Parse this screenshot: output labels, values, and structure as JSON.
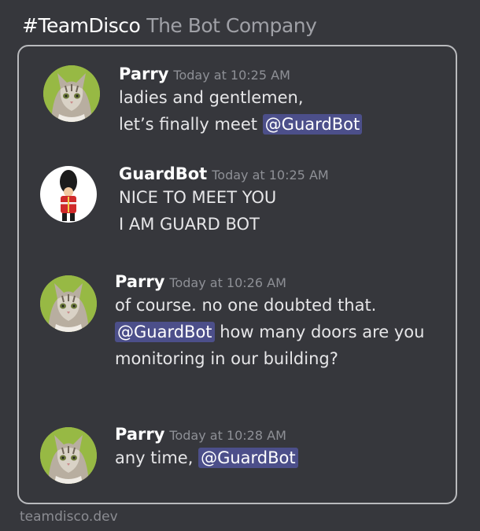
{
  "header": {
    "channel": "#TeamDisco",
    "company": "The Bot Company"
  },
  "messages": [
    {
      "author": "Parry",
      "time": "Today at 10:25 AM",
      "avatar": "cat-avatar",
      "line1": "ladies and gentlemen,",
      "line2_text": "let’s finally meet ",
      "line2_mention": "@GuardBot"
    },
    {
      "author": "GuardBot",
      "time": "Today at 10:25 AM",
      "avatar": "royal-guard-avatar",
      "line1": "NICE TO MEET YOU",
      "line2": "I AM GUARD BOT"
    },
    {
      "author": "Parry",
      "time": "Today at 10:26 AM",
      "avatar": "cat-avatar",
      "line1": "of course.  no one doubted that.",
      "line2_mention": "@GuardBot",
      "line2_text": " how many doors are you",
      "line3": "monitoring in our building?"
    },
    {
      "author": "Parry",
      "time": "Today at 10:28 AM",
      "avatar": "cat-avatar",
      "line1_text": "any time, ",
      "line1_mention": "@GuardBot"
    }
  ],
  "footer": {
    "site": "teamdisco.dev"
  },
  "colors": {
    "background": "#36373c",
    "mention_bg": "#4c4f8a",
    "border": "#b9babd"
  }
}
